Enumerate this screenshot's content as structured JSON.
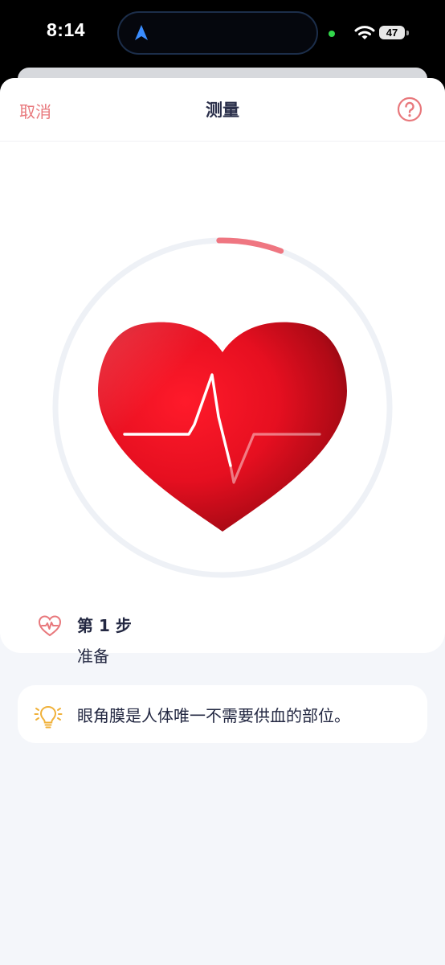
{
  "status_bar": {
    "time": "8:14",
    "battery_level": "47",
    "icons": [
      "navigation-arrow-icon",
      "wifi-icon",
      "battery-icon"
    ]
  },
  "nav": {
    "cancel_label": "取消",
    "title": "测量",
    "help_icon": "question-circle-icon"
  },
  "measurement": {
    "heart_icon": "heart-ecg-icon",
    "progress_fraction": 0.06,
    "colors": {
      "accent": "#e8787c",
      "progress": "#ef7681",
      "heart": "#e60f20",
      "track": "#eef1f6"
    }
  },
  "step": {
    "icon": "heart-pulse-icon",
    "title": "第 1 步",
    "status": "准备"
  },
  "tip": {
    "icon": "lightbulb-icon",
    "text": "眼角膜是人体唯一不需要供血的部位。"
  }
}
